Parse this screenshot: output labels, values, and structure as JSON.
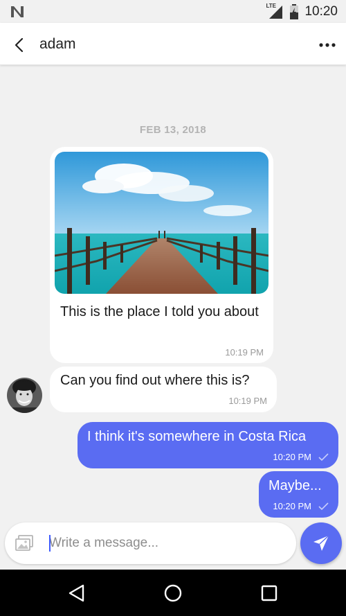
{
  "status_bar": {
    "time": "10:20",
    "network": "LTE",
    "icons": [
      "notification-n-icon",
      "signal-icon",
      "battery-icon"
    ]
  },
  "app_bar": {
    "title": "adam",
    "icons": [
      "back-arrow-icon",
      "more-vert-icon"
    ]
  },
  "chat": {
    "date_divider": "FEB 13, 2018",
    "messages": [
      {
        "direction": "incoming",
        "has_image": true,
        "image_icon": "pier-photo",
        "text": "This is the place I told you about",
        "time": "10:19 PM"
      },
      {
        "direction": "incoming",
        "avatar_icon": "avatar-adam",
        "text": "Can you find out where this is?",
        "time": "10:19 PM"
      },
      {
        "direction": "outgoing",
        "text": "I think it's somewhere in Costa Rica",
        "time": "10:20 PM",
        "status_icon": "check-icon"
      },
      {
        "direction": "outgoing",
        "text": "Maybe...",
        "time": "10:20 PM",
        "status_icon": "check-icon"
      }
    ]
  },
  "composer": {
    "placeholder": "Write a message...",
    "value": "",
    "attach_icon": "image-icon",
    "send_icon": "send-icon"
  },
  "nav_bar": {
    "icons": [
      "nav-back-icon",
      "nav-home-icon",
      "nav-recents-icon"
    ]
  },
  "colors": {
    "accent": "#5a6cf2",
    "background": "#f1f1f1",
    "bubble_in": "#ffffff",
    "caret": "#3d5afe"
  }
}
